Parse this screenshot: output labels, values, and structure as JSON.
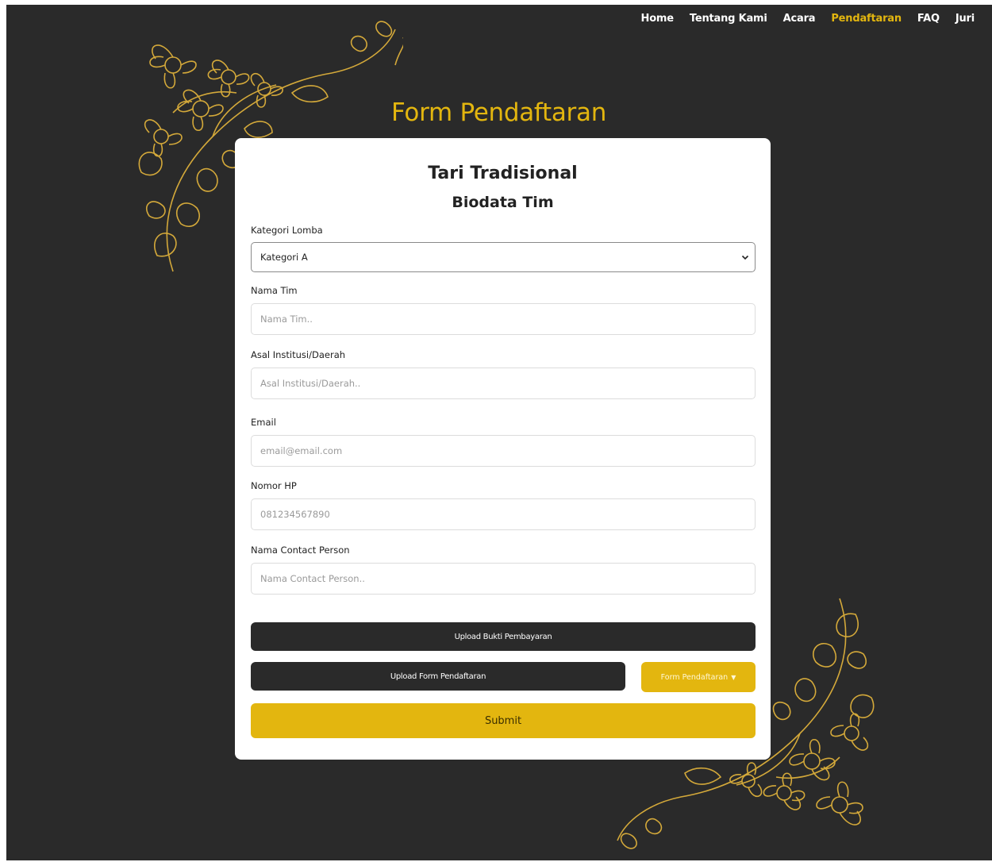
{
  "nav": {
    "items": [
      {
        "label": "Home",
        "active": false
      },
      {
        "label": "Tentang Kami",
        "active": false
      },
      {
        "label": "Acara",
        "active": false
      },
      {
        "label": "Pendaftaran",
        "active": true
      },
      {
        "label": "FAQ",
        "active": false
      },
      {
        "label": "Juri",
        "active": false
      }
    ]
  },
  "page": {
    "title": "Form Pendaftaran",
    "background_color": "#2a2a2a",
    "accent_color": "#e3b60f",
    "ornament_icon": "floral-ornament-icon"
  },
  "form": {
    "title": "Tari Tradisional",
    "subtitle": "Biodata Tim",
    "kategori": {
      "label": "Kategori Lomba",
      "value": "Kategori A"
    },
    "nama_tim": {
      "label": "Nama Tim",
      "placeholder": "Nama Tim.."
    },
    "asal": {
      "label": "Asal Institusi/Daerah",
      "placeholder": "Asal Institusi/Daerah.."
    },
    "email": {
      "label": "Email",
      "placeholder": "email@email.com"
    },
    "hp": {
      "label": "Nomor HP",
      "placeholder": "081234567890"
    },
    "contact": {
      "label": "Nama Contact Person",
      "placeholder": "Nama Contact Person.."
    },
    "upload_bukti": "Upload Bukti Pembayaran",
    "upload_form": "Upload Form Pendaftaran",
    "form_dropdown": "Form Pendaftaran",
    "submit": "Submit"
  }
}
